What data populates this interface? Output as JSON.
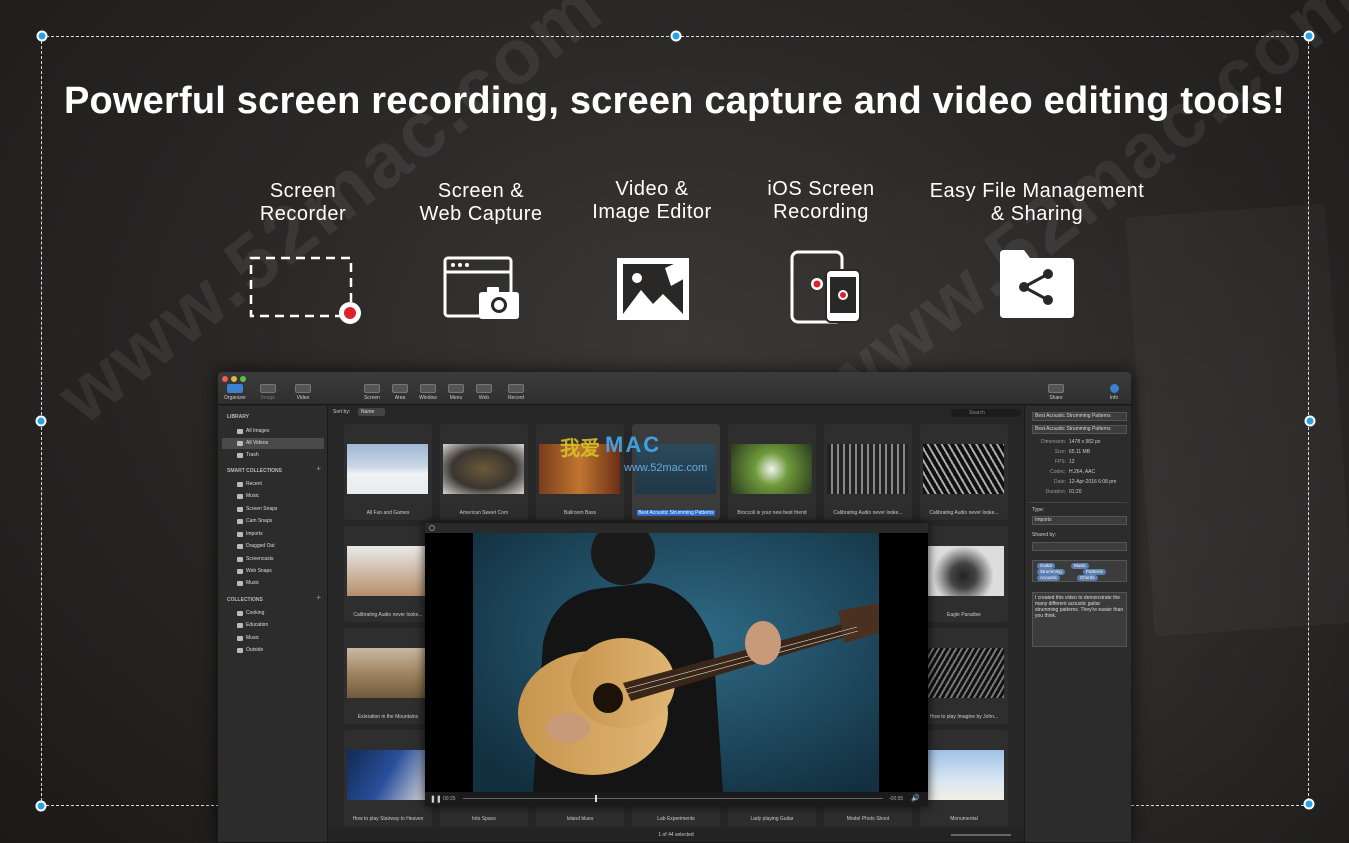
{
  "headline": "Powerful screen recording, screen capture and video editing tools!",
  "watermark": {
    "left": "www.52mac.com",
    "right": "www.52mac.com",
    "logo_cn": "我爱",
    "logo_mac": "MAC",
    "logo_url": "www.52mac.com"
  },
  "features": [
    {
      "title": "Screen\nRecorder",
      "icon": "dashed-rect-record-icon"
    },
    {
      "title": "Screen &\nWeb Capture",
      "icon": "browser-camera-icon"
    },
    {
      "title": "Video &\nImage Editor",
      "icon": "image-edit-icon"
    },
    {
      "title": "iOS Screen\nRecording",
      "icon": "ios-devices-icon"
    },
    {
      "title": "Easy File Management\n& Sharing",
      "icon": "share-folder-icon"
    }
  ],
  "app": {
    "toolbar": {
      "organizer": "Organizer",
      "image": "Image",
      "video": "Video",
      "screen": "Screen",
      "area": "Area",
      "window": "Window",
      "menu": "Menu",
      "web": "Web",
      "record": "Record",
      "share": "Share",
      "info": "Info"
    },
    "sidebar": {
      "library_header": "LIBRARY",
      "library": [
        "All Images",
        "All Videos",
        "Trash"
      ],
      "smart_header": "SMART COLLECTIONS",
      "smart": [
        "Recent",
        "Music",
        "Screen Snaps",
        "Cam Snaps",
        "Imports",
        "Dragged Out",
        "Screencasts",
        "Web Snaps",
        "Music"
      ],
      "collections_header": "COLLECTIONS",
      "collections": [
        "Cooking",
        "Education",
        "Music",
        "Outside"
      ]
    },
    "sort_label": "Sort by:",
    "sort_value": "Name",
    "search_placeholder": "Search",
    "grid_captions": [
      "All Fun and Games",
      "American Sweet Corn",
      "Ballroom Bass",
      "Best Acoustic Strumming Patterns",
      "Broccoli is your new best friend",
      "Calibrating Audio never looke...",
      "Calibrating Audio never looke...",
      "Calibrating Audio never looke...",
      "Eagle Paradise",
      "Exloration in the Mountains",
      "How to play Imagine by John...",
      "How to play Stairway to Heaven",
      "Into Space",
      "Island blues",
      "Lab Experiments",
      "Lady playing Guitar",
      "Model Photo Shoot",
      "Monumental"
    ],
    "player": {
      "time_elapsed": "00:25",
      "time_remaining": "-00:55"
    },
    "status": "1 of 44 selected",
    "info": {
      "title_field": "Best Acoustic Strumming Patterns",
      "title_field2": "Best Acoustic Strumming Patterns",
      "dimension_label": "Dimension:",
      "dimension": "1478 x 982 px",
      "size_label": "Size:",
      "size": "65.11 MB",
      "fps_label": "FPS:",
      "fps": "12",
      "codec_label": "Codec:",
      "codec": "H.264, AAC",
      "date_label": "Date:",
      "date": "12-Apr-2016 6:08 pm",
      "duration_label": "Duration:",
      "duration": "01:20",
      "type_label": "Type:",
      "type_value": "Imports",
      "shared_label": "Shared by:",
      "tags": [
        "Guitar",
        "Music",
        "Strumming",
        "Patterns",
        "Acoustic",
        "Chords"
      ],
      "description": "I created this video to demonstrate the many different acoustic guitar strumming patterns. They're easier than you think."
    }
  }
}
